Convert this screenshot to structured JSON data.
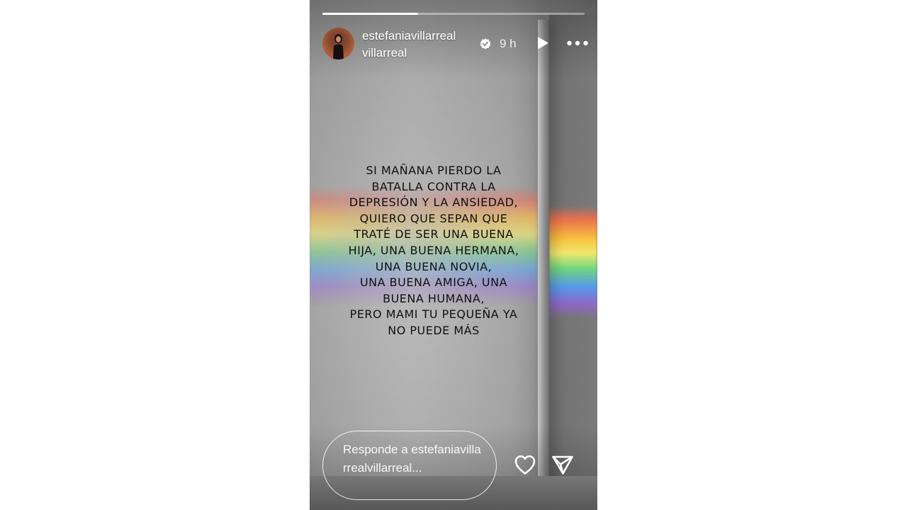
{
  "story": {
    "progress": 0.365,
    "username": "estefaniavillarrealvillarreal",
    "verified": true,
    "time": "9 h",
    "icons": {
      "verified": "verified-badge-icon",
      "play": "play-icon",
      "more": "more-options-icon",
      "heart": "heart-icon",
      "send": "send-icon"
    },
    "message_lines": [
      "SI MAÑANA PIERDO LA",
      "BATALLA CONTRA LA",
      "DEPRESIÓN Y LA ANSIEDAD,",
      "QUIERO QUE SEPAN QUE",
      "TRATÉ DE SER UNA BUENA",
      "HIJA, UNA BUENA HERMANA,",
      "UNA BUENA NOVIA,",
      "UNA BUENA AMIGA, UNA",
      "BUENA HUMANA,",
      "PERO MAMI  TU PEQUEÑA YA",
      "NO PUEDE MÁS"
    ]
  },
  "reply": {
    "placeholder": "Responde a estefaniavillarrealvillarreal..."
  },
  "colors": {
    "page_background": "#ffffff",
    "text_on_story": "#ffffff",
    "message_text": "#111111"
  }
}
